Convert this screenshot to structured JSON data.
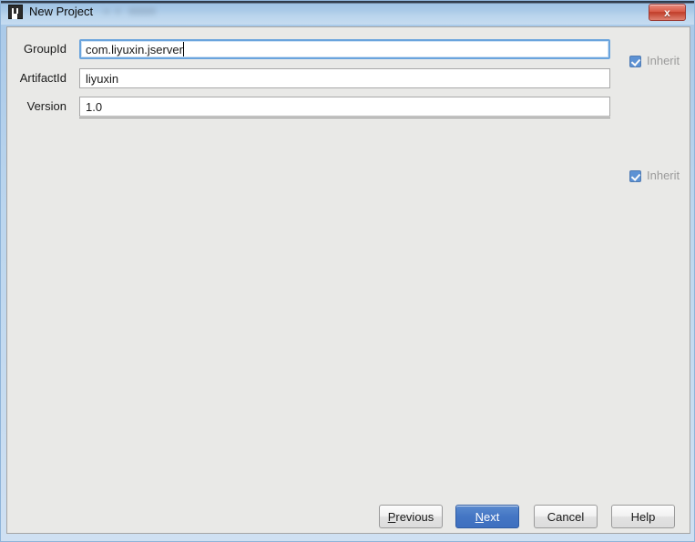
{
  "window": {
    "title": "New Project",
    "app_icon": "intellij-idea-icon",
    "close_label": "x",
    "frame_color": "#a8c8e8",
    "body_color": "#e9e9e7"
  },
  "form": {
    "fields": [
      {
        "label": "GroupId",
        "value": "com.liyuxin.jserver",
        "placeholder": "",
        "focused": true,
        "inherit": {
          "label": "Inherit",
          "checked": true,
          "enabled": false
        }
      },
      {
        "label": "ArtifactId",
        "value": "liyuxin",
        "placeholder": "",
        "focused": false,
        "inherit": null
      },
      {
        "label": "Version",
        "value": "1.0",
        "placeholder": "",
        "focused": false,
        "inherit": {
          "label": "Inherit",
          "checked": true,
          "enabled": false
        }
      }
    ]
  },
  "buttons": {
    "previous": {
      "label": "Previous",
      "mnemonic": "P"
    },
    "next": {
      "label": "Next",
      "mnemonic": "N",
      "default": true,
      "accent": "#4476c4"
    },
    "cancel": {
      "label": "Cancel"
    },
    "help": {
      "label": "Help"
    }
  }
}
